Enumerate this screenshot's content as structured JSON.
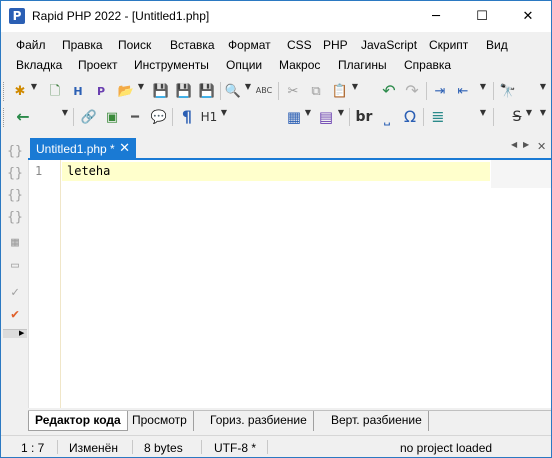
{
  "window": {
    "title": "Rapid PHP 2022 - [Untitled1.php]",
    "app_icon_letter": "P",
    "minimize": "─",
    "maximize": "☐",
    "close": "✕"
  },
  "menu": {
    "row1": [
      "Файл",
      "Правка",
      "Поиск",
      "Вставка",
      "Формат",
      "CSS",
      "PHP",
      "JavaScript",
      "Скрипт",
      "Вид"
    ],
    "row2": [
      "Вкладка",
      "Проект",
      "Инструменты",
      "Опции",
      "Макрос",
      "Плагины",
      "Справка"
    ]
  },
  "toolbar1": {
    "new": "✱",
    "new_file": "🗋",
    "html_file": "H",
    "php_file": "P",
    "open": "📂",
    "save": "💾",
    "save_as": "💾",
    "save_all": "💾",
    "search": "🔍",
    "spell": "ABC",
    "cut": "✂",
    "copy": "⧉",
    "paste": "📋",
    "undo": "↶",
    "redo": "↷",
    "indent": "⇥",
    "outdent": "⇤",
    "binoculars": "🔭"
  },
  "toolbar2": {
    "back": "←",
    "link": "🔗",
    "image": "▣",
    "hr": "━",
    "comment": "💬",
    "paragraph": "¶",
    "heading": "H1",
    "table": "▦",
    "form": "▤",
    "br": "br",
    "space": "⎵",
    "omega": "Ω",
    "style": "≣",
    "strike": "S"
  },
  "side_icons": [
    "{}",
    "{}",
    "{}",
    "{}",
    "▦",
    "▭",
    "✓",
    "✔"
  ],
  "tabs": [
    {
      "label": "Untitled1.php *",
      "close": "✕"
    }
  ],
  "tab_nav": {
    "prev": "◀",
    "next": "▶",
    "close_all": "✕"
  },
  "editor": {
    "line_number": "1",
    "code": "leteha"
  },
  "view_tabs": [
    "Редактор кода",
    "Просмотр",
    "Гориз. разбиение",
    "Верт. разбиение"
  ],
  "status": {
    "position": "1 : 7",
    "modified": "Изменён",
    "size": "8 bytes",
    "encoding": "UTF-8 *",
    "project": "no project loaded"
  },
  "colors": {
    "accent": "#1a7ad4",
    "current_line": "#ffffcc",
    "title_border": "#2b79c2"
  }
}
